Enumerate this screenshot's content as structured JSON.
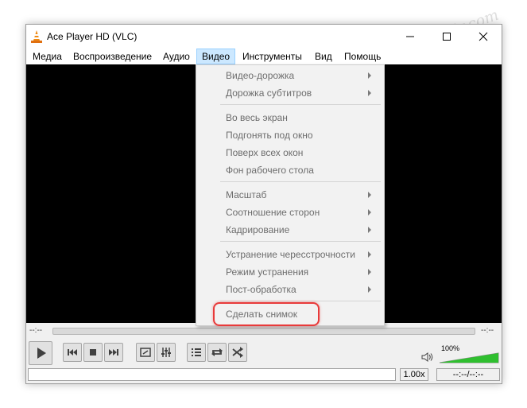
{
  "window": {
    "title": "Ace Player HD (VLC)"
  },
  "menubar": {
    "items": [
      "Медиа",
      "Воспроизведение",
      "Аудио",
      "Видео",
      "Инструменты",
      "Вид",
      "Помощь"
    ]
  },
  "video_menu": {
    "items": [
      {
        "label": "Видео-дорожка"
      },
      {
        "label": "Дорожка субтитров"
      },
      {
        "label": "Во весь экран"
      },
      {
        "label": "Подгонять под окно"
      },
      {
        "label": "Поверх всех окон"
      },
      {
        "label": "Фон рабочего стола"
      },
      {
        "label": "Масштаб"
      },
      {
        "label": "Соотношение сторон"
      },
      {
        "label": "Кадрирование"
      },
      {
        "label": "Устранение чересстрочности"
      },
      {
        "label": "Режим устранения"
      },
      {
        "label": "Пост-обработка"
      },
      {
        "label": "Сделать снимок"
      }
    ]
  },
  "seek": {
    "elapsed": "--:--",
    "remaining": "--:--"
  },
  "volume": {
    "percent_label": "100%",
    "level": 1.0
  },
  "status": {
    "speed": "1.00x",
    "time": "--:--/--:--"
  },
  "icons": {
    "app": "traffic-cone-icon",
    "play": "play-icon",
    "prev": "skip-back-icon",
    "stop": "stop-icon",
    "next": "skip-forward-icon",
    "fullscreen": "fullscreen-icon",
    "equalizer": "equalizer-icon",
    "playlist": "playlist-icon",
    "loop": "loop-icon",
    "shuffle": "shuffle-icon",
    "speaker": "speaker-icon"
  },
  "colors": {
    "menu_highlight": "#cce8ff",
    "snapshot_outline": "#e83a3a",
    "volume_fill": "#2fbf2f"
  },
  "watermark": "Sovinggorepair.com"
}
